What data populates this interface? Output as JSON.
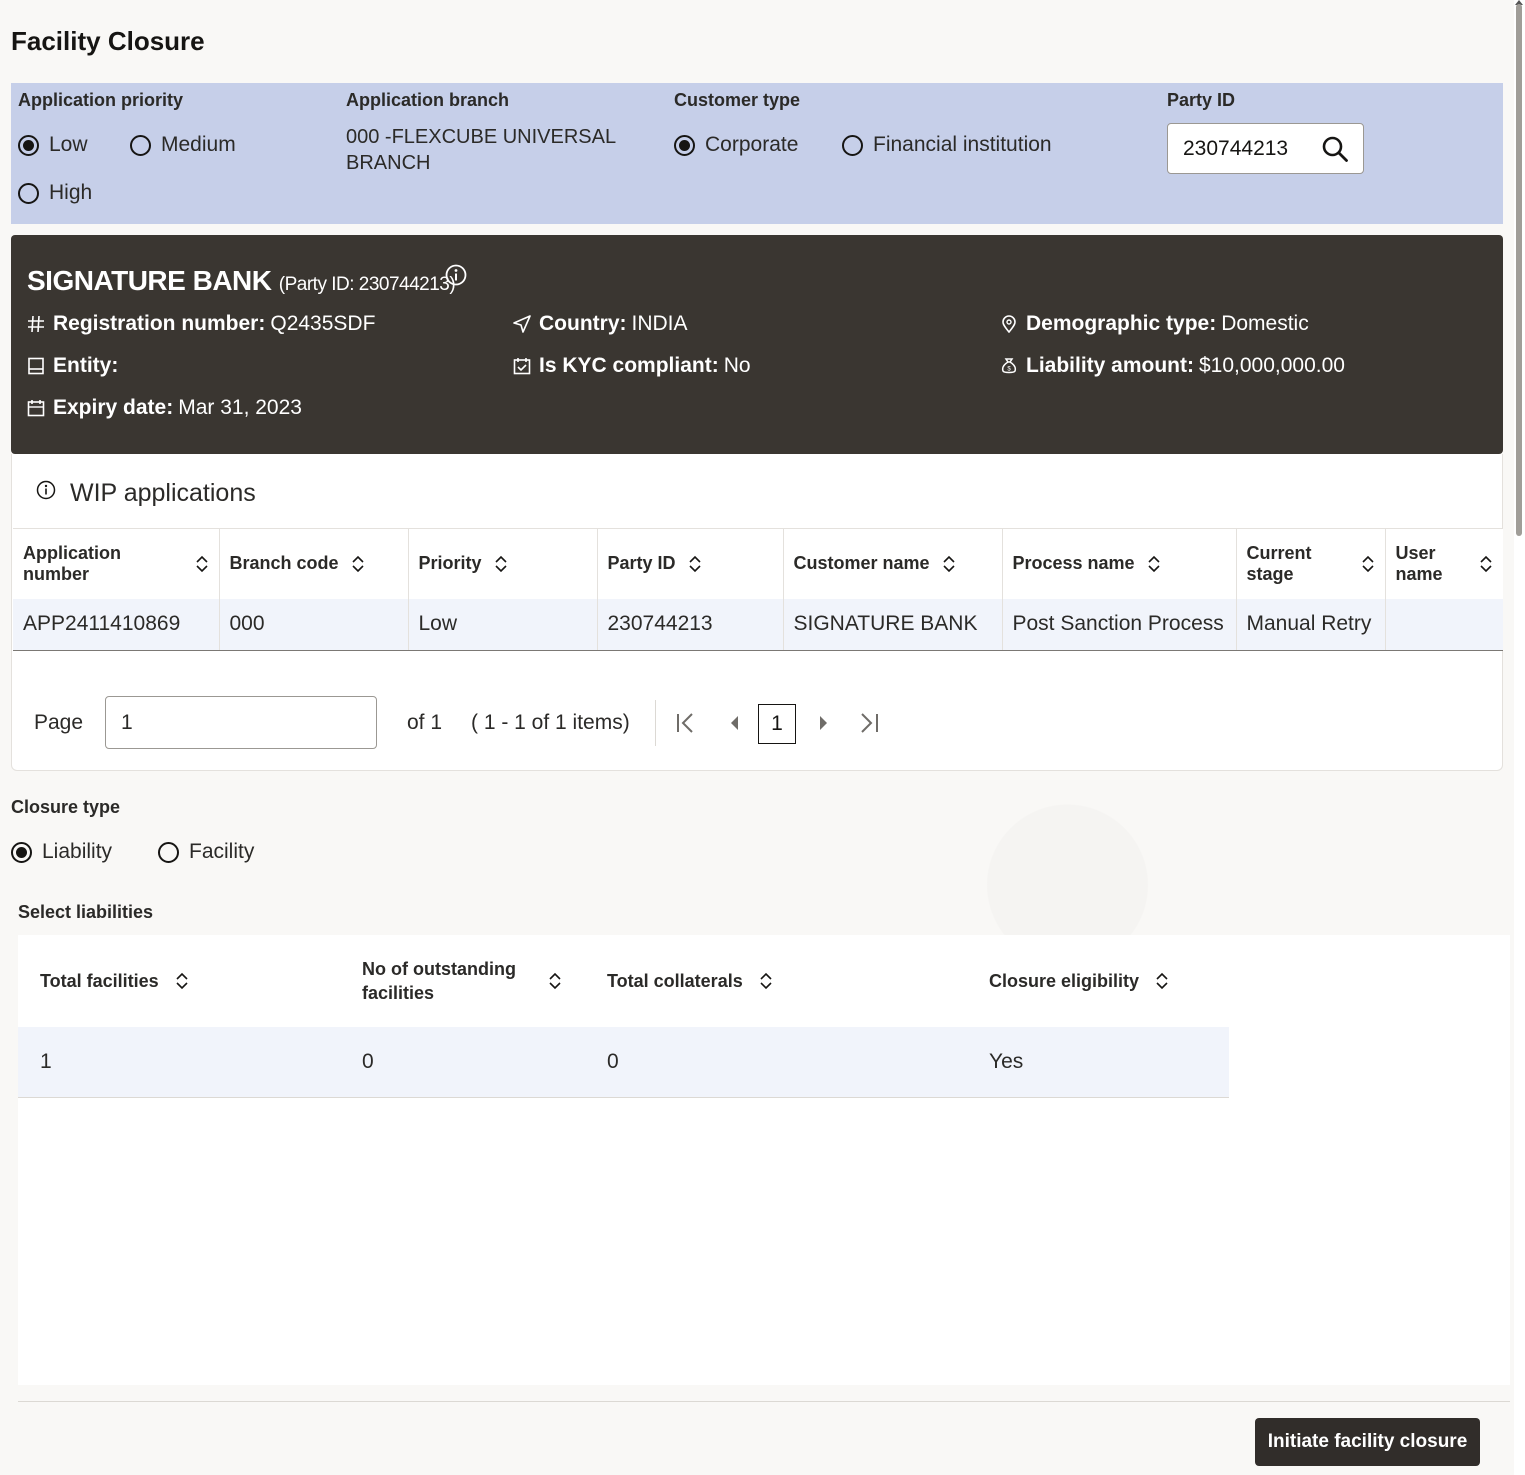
{
  "page": {
    "title": "Facility Closure"
  },
  "header": {
    "priority_label": "Application priority",
    "priority_options": [
      "Low",
      "Medium",
      "High"
    ],
    "priority_selected": "Low",
    "branch_label": "Application branch",
    "branch_value": "000 -FLEXCUBE UNIVERSAL BRANCH",
    "customer_type_label": "Customer type",
    "customer_type_options": [
      "Corporate",
      "Financial institution"
    ],
    "customer_type_selected": "Corporate",
    "party_id_label": "Party ID",
    "party_id_value": "230744213"
  },
  "party_card": {
    "name": "SIGNATURE BANK",
    "party_sub": "(Party ID: 230744213)",
    "registration_label": "Registration number:",
    "registration_value": "Q2435SDF",
    "country_label": "Country:",
    "country_value": "INDIA",
    "demographic_label": "Demographic type:",
    "demographic_value": "Domestic",
    "entity_label": "Entity:",
    "entity_value": "",
    "kyc_label": "Is KYC compliant:",
    "kyc_value": "No",
    "liability_label": "Liability amount:",
    "liability_value": "$10,000,000.00",
    "expiry_label": "Expiry date:",
    "expiry_value": "Mar 31, 2023"
  },
  "wip": {
    "title": "WIP applications",
    "columns": [
      "Application number",
      "Branch code",
      "Priority",
      "Party ID",
      "Customer name",
      "Process name",
      "Current stage",
      "User name"
    ],
    "rows": [
      [
        "APP2411410869",
        "000",
        "Low",
        "230744213",
        "SIGNATURE BANK",
        "Post Sanction Process",
        "Manual Retry",
        ""
      ]
    ],
    "pager": {
      "page_label": "Page",
      "page_value": "1",
      "of_text": "of 1",
      "items_text": "( 1 - 1 of 1 items)",
      "current_page": "1"
    }
  },
  "closure": {
    "label": "Closure type",
    "options": [
      "Liability",
      "Facility"
    ],
    "selected": "Liability"
  },
  "liabilities": {
    "label": "Select liabilities",
    "columns": [
      "Total facilities",
      "No of outstanding facilities",
      "Total collaterals",
      "Closure eligibility"
    ],
    "rows": [
      [
        "1",
        "0",
        "0",
        "Yes"
      ]
    ]
  },
  "footer": {
    "primary_button": "Initiate facility closure"
  }
}
